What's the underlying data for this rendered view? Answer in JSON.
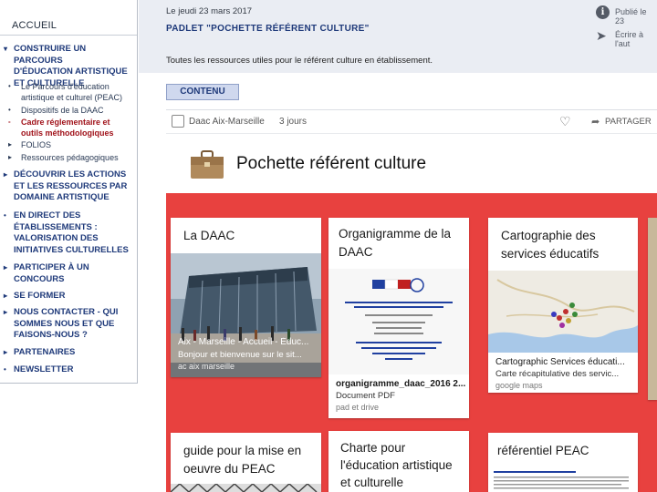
{
  "nav": {
    "title": "ACCUEIL",
    "items": [
      {
        "label_lines": [
          "CONSTRUIRE UN PARCOURS",
          "D'ÉDUCATION ARTISTIQUE",
          "ET CULTURELLE"
        ]
      },
      {
        "label_lines": [
          "DÉCOUVRIR LES ACTIONS",
          "ET LES RESSOURCES PAR",
          "DOMAINE ARTISTIQUE"
        ]
      },
      {
        "label_lines": [
          "EN DIRECT DES",
          "ÉTABLISSEMENTS :",
          "VALORISATION DES",
          "INITIATIVES CULTURELLES"
        ]
      },
      {
        "label_lines": [
          "PARTICIPER À UN",
          "CONCOURS"
        ]
      },
      {
        "label_lines": [
          "SE FORMER"
        ]
      },
      {
        "label_lines": [
          "NOUS CONTACTER - QUI",
          "SOMMES NOUS ET QUE",
          "FAISONS-NOUS ?"
        ]
      },
      {
        "label_lines": [
          "PARTENAIRES"
        ]
      },
      {
        "label_lines": [
          "NEWSLETTER"
        ]
      }
    ],
    "sub_items": [
      {
        "label_lines": [
          "Le Parcours d'éducation",
          "artistique et culturel (PEAC)"
        ]
      },
      {
        "label_lines": [
          "Dispositifs de la DAAC"
        ]
      },
      {
        "label_lines": [
          "Cadre réglementaire et",
          "outils méthodologiques"
        ]
      },
      {
        "label_lines": [
          "FOLIOS"
        ]
      },
      {
        "label_lines": [
          "Ressources pédagogiques"
        ]
      }
    ]
  },
  "post": {
    "date": "Le jeudi 23 mars 2017",
    "title": "PADLET \"POCHETTE RÉFÉRENT CULTURE\"",
    "description": "Toutes les ressources utiles pour le référent culture en établissement.",
    "published_label": "Publié le 23",
    "write_label": "Écrire à l'aut",
    "tab_label": "CONTENU"
  },
  "padlet": {
    "author": "Daac Aix-Marseille",
    "time": "3 jours",
    "share_label": "PARTAGER",
    "title": "Pochette référent culture",
    "cards": [
      {
        "title": "La DAAC",
        "link_title": "Aix - Marseille - Accueil - Éduc...",
        "link_desc": "Bonjour et bienvenue sur le sit...",
        "link_meta": "ac aix marseille"
      },
      {
        "title_lines": [
          "Organigramme de la",
          "DAAC"
        ],
        "file_title": "organigramme_daac_2016 2...",
        "file_type": "Document PDF",
        "file_meta": "pad et drive"
      },
      {
        "title_lines": [
          "Cartographie des",
          "services éducatifs"
        ],
        "link_title": "Cartographic Services éducati...",
        "link_desc": "Carte récapitulative des servic...",
        "link_meta": "google maps"
      },
      {
        "title_lines": [
          "guide pour la mise en",
          "oeuvre du PEAC"
        ]
      },
      {
        "title_lines": [
          "Charte pour",
          "l'éducation artistique",
          "et culturelle"
        ]
      },
      {
        "title_lines": [
          "référentiel PEAC"
        ]
      }
    ]
  },
  "colors": {
    "wall": "#e8413f",
    "nav_link": "#1f3a7a",
    "nav_active": "#a0121a"
  },
  "icons": [
    "info-icon",
    "send-icon",
    "heart-icon",
    "share-icon",
    "briefcase-icon"
  ]
}
